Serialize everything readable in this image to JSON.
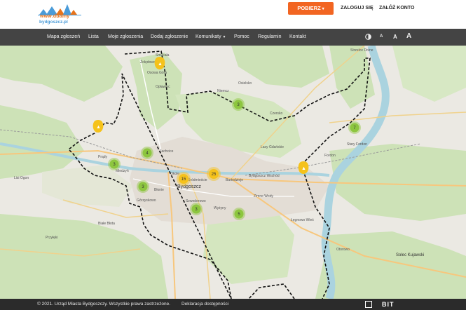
{
  "header": {
    "logo_line1": "www.dbamy",
    "logo_line2": "bydgoszcz.pl",
    "download_label": "POBIERZ",
    "login_label": "ZALOGUJ SIĘ",
    "register_label": "ZAŁÓŻ KONTO"
  },
  "nav": {
    "items": [
      "Mapa zgłoszeń",
      "Lista",
      "Moje zgłoszenia",
      "Dodaj zgłoszenie",
      "Komunikaty",
      "Pomoc",
      "Regulamin",
      "Kontakt"
    ],
    "contrast_icon": "contrast-icon",
    "font_sizes": [
      "A",
      "A",
      "A"
    ]
  },
  "map": {
    "clusters": [
      {
        "count": "4"
      },
      {
        "count": "3"
      },
      {
        "count": "3"
      },
      {
        "count": "15"
      },
      {
        "count": "25"
      },
      {
        "count": "3"
      },
      {
        "count": "5"
      },
      {
        "count": "3"
      },
      {
        "count": "7"
      }
    ],
    "labels": [
      "Bydgoszcz",
      "Osowa Góra",
      "Miedzyń",
      "Prądy",
      "Jachcice",
      "Okole",
      "Śródmieście",
      "Bartodzieje",
      "Fordon",
      "Czersko",
      "Wyżyny",
      "Szwederowo",
      "Błonie",
      "Górzyskowo",
      "Bydgoszcz Wschód",
      "Zimne Wody",
      "Otorowo",
      "Solec Kujawski",
      "Osielsko",
      "Niemcz",
      "Żołędowo",
      "Opławiec",
      "Lasy Gdańskie",
      "Smukała",
      "Białe Błota",
      "Lisi Ogon",
      "Przyłęki",
      "Łęgnowo Wieś",
      "Stary Fordon",
      "Strzelce Dolne"
    ],
    "colors": {
      "cluster": "#8dc63f",
      "cluster_big": "#f5c21b",
      "marker": "#f5c21b",
      "forest": "#cde2b7",
      "water": "#aad3df",
      "boundary": "#111111"
    }
  },
  "footer": {
    "copyright": "© 2021. Urząd Miasta Bydgoszczy. Wszystkie prawa zastrzeżone.",
    "accessibility": "Deklaracja dostępności",
    "brand": "BIT"
  }
}
